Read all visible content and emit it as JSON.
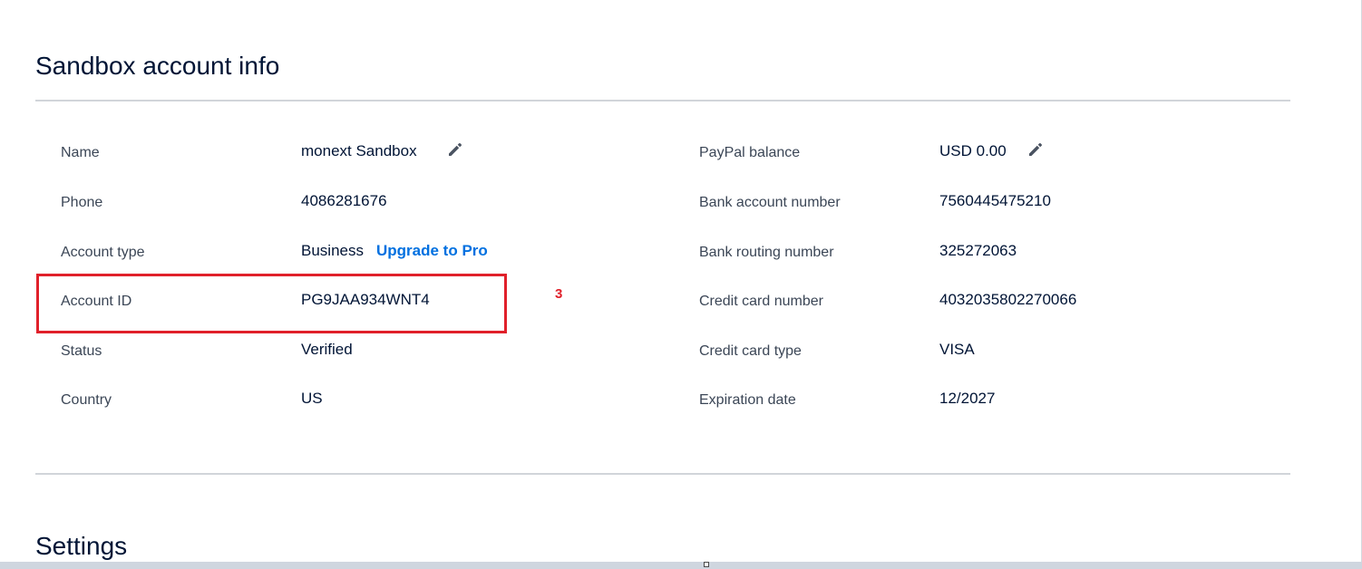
{
  "account_info": {
    "title": "Sandbox account info",
    "left": {
      "name_label": "Name",
      "name_value": "monext Sandbox",
      "phone_label": "Phone",
      "phone_value": "4086281676",
      "account_type_label": "Account type",
      "account_type_value": "Business",
      "upgrade_link": "Upgrade to Pro",
      "account_id_label": "Account ID",
      "account_id_value": "PG9JAA934WNT4",
      "status_label": "Status",
      "status_value": "Verified",
      "country_label": "Country",
      "country_value": "US"
    },
    "right": {
      "balance_label": "PayPal balance",
      "balance_value": "USD 0.00",
      "bank_account_label": "Bank account number",
      "bank_account_value": "7560445475210",
      "routing_label": "Bank routing number",
      "routing_value": "325272063",
      "card_number_label": "Credit card number",
      "card_number_value": "4032035802270066",
      "card_type_label": "Credit card type",
      "card_type_value": "VISA",
      "expiration_label": "Expiration date",
      "expiration_value": "12/2027"
    }
  },
  "annotation": {
    "number": "3",
    "color": "#e0202a"
  },
  "settings": {
    "title": "Settings"
  },
  "icons": {
    "edit": "pencil-icon"
  },
  "colors": {
    "text": "#001435",
    "label": "#3b4656",
    "link": "#0070e0",
    "divider": "#d1d5da"
  }
}
